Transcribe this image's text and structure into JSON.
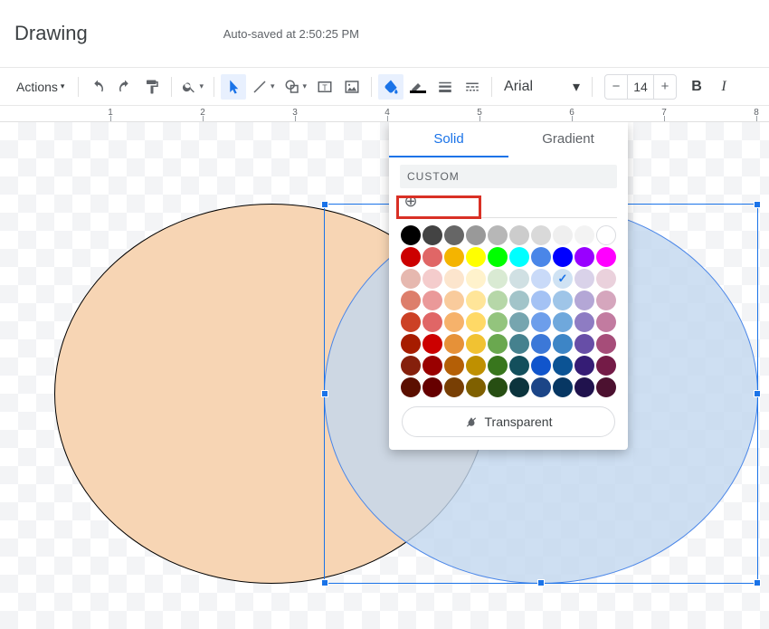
{
  "header": {
    "title": "Drawing",
    "autosave": "Auto-saved at 2:50:25 PM"
  },
  "toolbar": {
    "actions_label": "Actions",
    "font_name": "Arial",
    "font_size": "14"
  },
  "popover": {
    "tabs": {
      "solid": "Solid",
      "gradient": "Gradient"
    },
    "custom_label": "CUSTOM",
    "transparent_label": "Transparent",
    "greys": [
      "#000000",
      "#434343",
      "#666666",
      "#999999",
      "#b7b7b7",
      "#cccccc",
      "#d9d9d9",
      "#efefef",
      "#f3f3f3",
      "#ffffff"
    ],
    "main": [
      "#cc0000",
      "#e06666",
      "#f4b400",
      "#ffff00",
      "#00ff00",
      "#00ffff",
      "#4a86e8",
      "#0000ff",
      "#9900ff",
      "#ff00ff"
    ],
    "light3": [
      "#e6b8af",
      "#f4cccc",
      "#fce5cd",
      "#fff2cc",
      "#d9ead3",
      "#d0e0e3",
      "#c9daf8",
      "#cfe2f3",
      "#d9d2e9",
      "#ead1dc"
    ],
    "light2": [
      "#dd7e6b",
      "#ea9999",
      "#f9cb9c",
      "#ffe599",
      "#b6d7a8",
      "#a2c4c9",
      "#a4c2f4",
      "#9fc5e8",
      "#b4a7d6",
      "#d5a6bd"
    ],
    "light1": [
      "#cc4125",
      "#e06666",
      "#f6b26b",
      "#ffd966",
      "#93c47d",
      "#76a5af",
      "#6d9eeb",
      "#6fa8dc",
      "#8e7cc3",
      "#c27ba0"
    ],
    "dark1": [
      "#a61c00",
      "#cc0000",
      "#e69138",
      "#f1c232",
      "#6aa84f",
      "#45818e",
      "#3c78d8",
      "#3d85c6",
      "#674ea7",
      "#a64d79"
    ],
    "dark2": [
      "#85200c",
      "#990000",
      "#b45f06",
      "#bf9000",
      "#38761d",
      "#134f5c",
      "#1155cc",
      "#0b5394",
      "#351c75",
      "#741b47"
    ],
    "dark3": [
      "#5b0f00",
      "#660000",
      "#783f04",
      "#7f6000",
      "#274e13",
      "#0c343d",
      "#1c4587",
      "#073763",
      "#20124d",
      "#4c1130"
    ],
    "selected_swatch": "#cfe2f3"
  },
  "ruler": {
    "labels": [
      "1",
      "2",
      "3",
      "4",
      "5",
      "6",
      "7",
      "8"
    ]
  }
}
